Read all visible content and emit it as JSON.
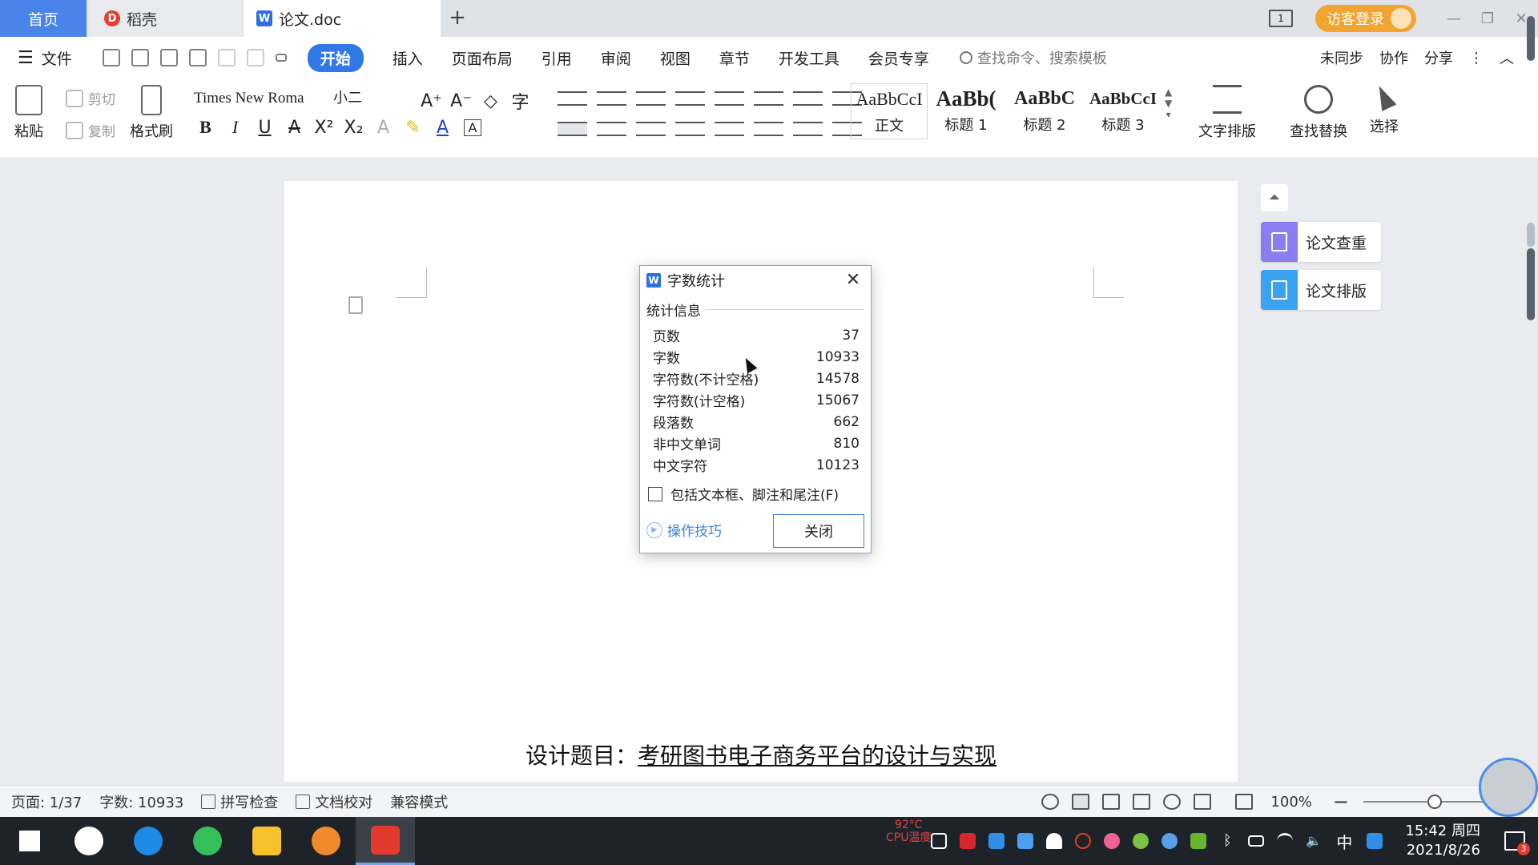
{
  "tabs": {
    "home": "首页",
    "daoke": "稻壳",
    "doc": "论文.doc",
    "new_tab": "+"
  },
  "titlebar": {
    "twin_label": "1",
    "login": "访客登录",
    "minimize": "—",
    "restore": "❐",
    "close": "✕"
  },
  "menu": {
    "file": "文件",
    "tabs": [
      "开始",
      "插入",
      "页面布局",
      "引用",
      "审阅",
      "视图",
      "章节",
      "开发工具",
      "会员专享"
    ],
    "search_placeholder": "查找命令、搜索模板",
    "sync": "未同步",
    "collab": "协作",
    "share": "分享"
  },
  "ribbon": {
    "paste": "粘贴",
    "cut": "剪切",
    "copy": "复制",
    "format_painter": "格式刷",
    "font_name": "Times New Roma",
    "font_size": "小二",
    "format_buttons": [
      "B",
      "I",
      "U",
      "A",
      "X²",
      "X₂",
      "A",
      "✎",
      "A",
      "A"
    ],
    "styles": [
      {
        "preview": "AaBbCcI",
        "name": "正文"
      },
      {
        "preview": "AaBb(",
        "name": "标题 1"
      },
      {
        "preview": "AaBbC",
        "name": "标题 2"
      },
      {
        "preview": "AaBbCcI",
        "name": "标题 3"
      }
    ],
    "text_layout": "文字排版",
    "find_replace": "查找替换",
    "select": "选择"
  },
  "document": {
    "title_prefix": "设计题目：",
    "title_main": "考研图书电子商务平台的设计与实现"
  },
  "side_panel": {
    "check": "论文查重",
    "format": "论文排版"
  },
  "dialog": {
    "title": "字数统计",
    "section": "统计信息",
    "stats": [
      {
        "label": "页数",
        "value": "37"
      },
      {
        "label": "字数",
        "value": "10933"
      },
      {
        "label": "字符数(不计空格)",
        "value": "14578"
      },
      {
        "label": "字符数(计空格)",
        "value": "15067"
      },
      {
        "label": "段落数",
        "value": "662"
      },
      {
        "label": "非中文单词",
        "value": "810"
      },
      {
        "label": "中文字符",
        "value": "10123"
      }
    ],
    "include_checkbox": "包括文本框、脚注和尾注(F)",
    "include_checked": false,
    "tips": "操作技巧",
    "close_button": "关闭"
  },
  "statusbar": {
    "page": "页面: 1/37",
    "words": "字数: 10933",
    "spell": "拼写检查",
    "proof": "文档校对",
    "compat": "兼容模式",
    "zoom": "100%",
    "zoom_level": 0.5
  },
  "taskbar": {
    "cpu_temp": "92°C",
    "cpu_label": "CPU温度",
    "ime": "中",
    "time": "15:42 周四",
    "date": "2021/8/26",
    "notify_count": "3"
  },
  "colors": {
    "accent": "#2f78e6",
    "home_tab": "#4a84e8",
    "login": "#f2a431",
    "side_check": "#8a7ff2",
    "side_format": "#3aa2f0"
  }
}
